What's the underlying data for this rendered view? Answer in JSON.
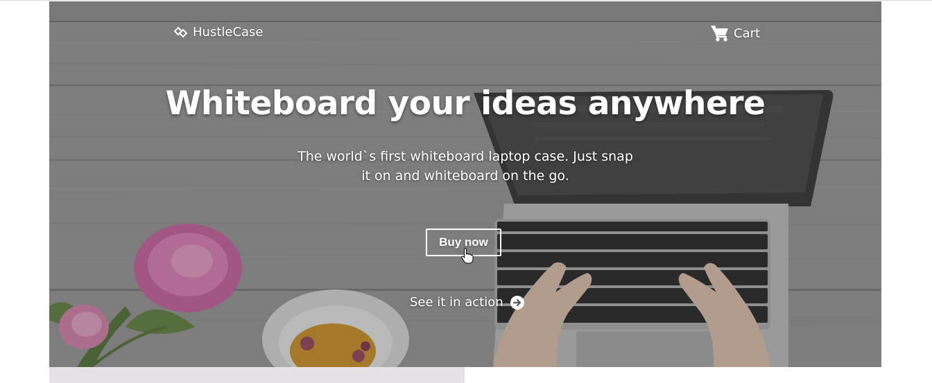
{
  "nav": {
    "brand": "HustleCase",
    "brand_icon": "diamond-logo-icon",
    "cart_label": "Cart",
    "cart_icon": "shopping-cart-icon"
  },
  "hero": {
    "headline": "Whiteboard your ideas anywhere",
    "subtitle": "The world`s first whiteboard laptop case. Just snap it on and whiteboard on the go.",
    "buy_label": "Buy now",
    "action_label": "See it in action",
    "action_icon": "arrow-right-circle-icon",
    "cursor_icon": "hand-pointer-icon"
  },
  "colors": {
    "text": "#ffffff",
    "overlay": "#6e6e6e",
    "below_strip": "#e4e2e4"
  }
}
